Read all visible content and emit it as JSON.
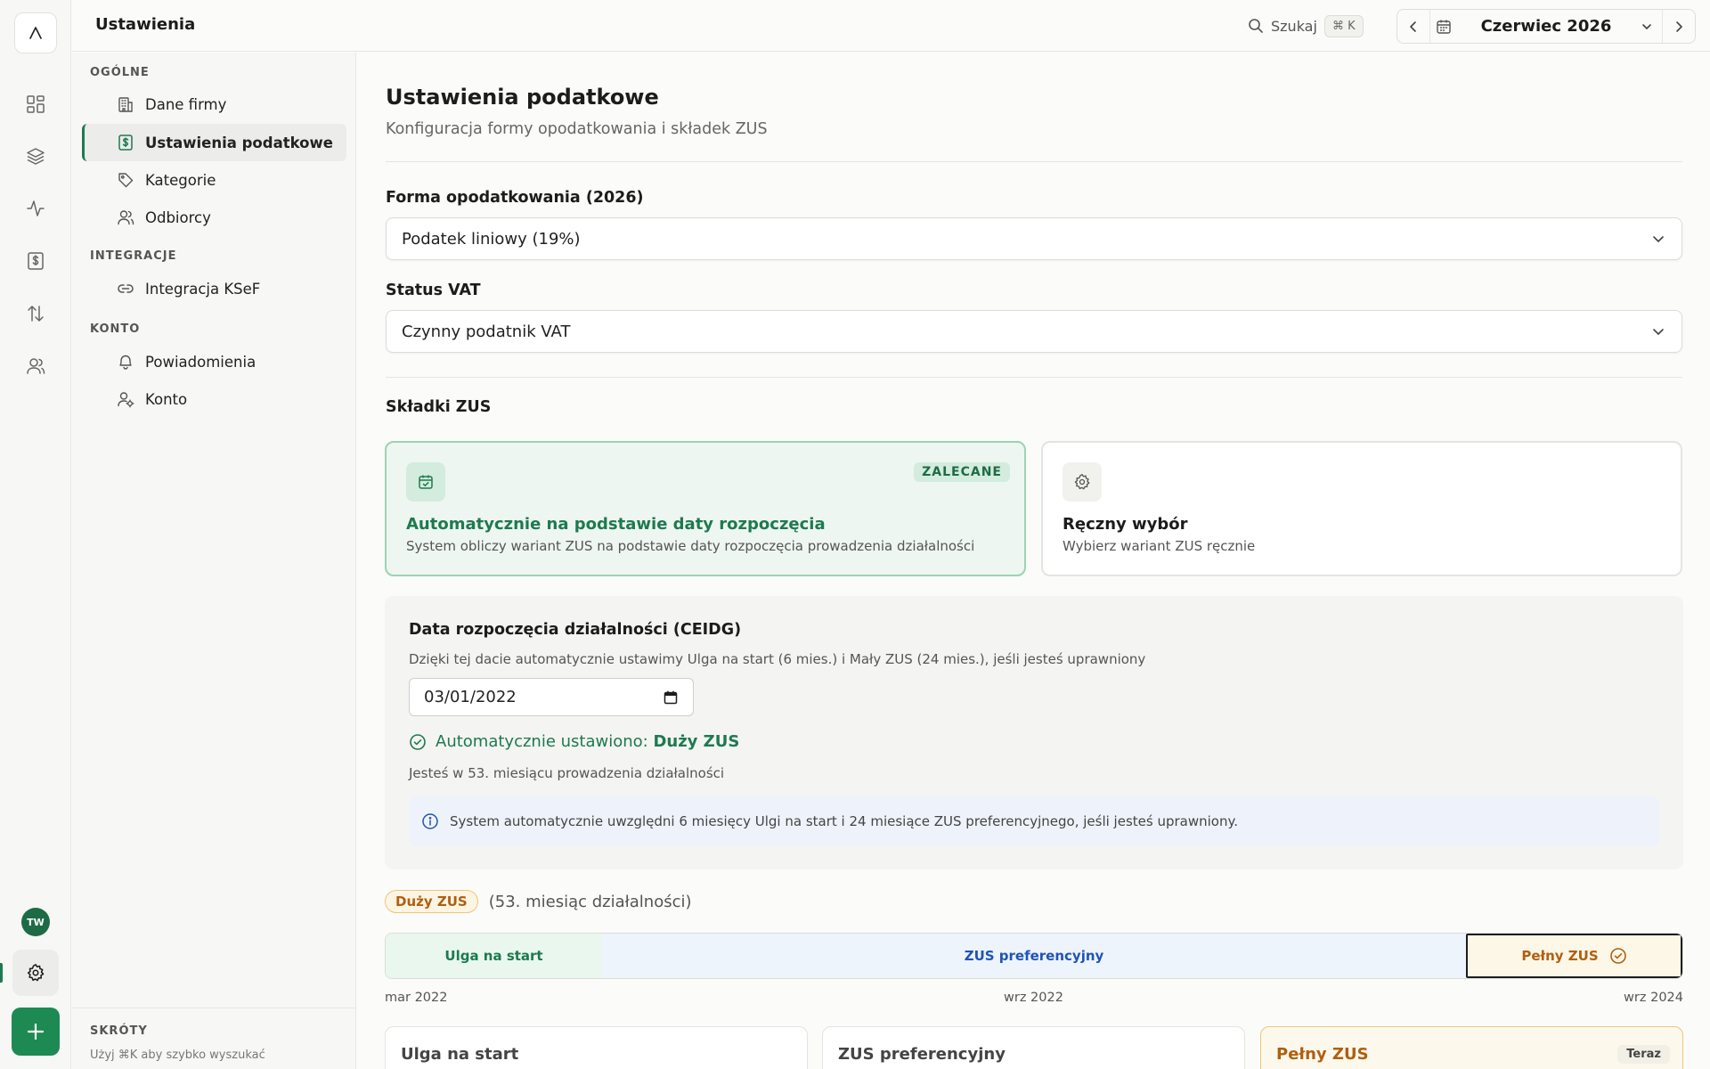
{
  "app": {
    "title": "Ustawienia",
    "user_initials": "TW"
  },
  "search": {
    "label": "Szukaj",
    "shortcut": "⌘ K"
  },
  "period": {
    "month": "Czerwiec 2026"
  },
  "sidebar": {
    "sections": [
      {
        "title": "OGÓLNE"
      },
      {
        "title": "INTEGRACJE"
      },
      {
        "title": "KONTO"
      }
    ],
    "items": [
      {
        "label": "Dane firmy",
        "icon": "building-icon"
      },
      {
        "label": "Ustawienia podatkowe",
        "icon": "tax-icon",
        "active": true
      },
      {
        "label": "Kategorie",
        "icon": "tag-icon"
      },
      {
        "label": "Odbiorcy",
        "icon": "users-icon"
      },
      {
        "label": "Integracja KSeF",
        "icon": "link-icon"
      },
      {
        "label": "Powiadomienia",
        "icon": "bell-icon"
      },
      {
        "label": "Konto",
        "icon": "user-gear-icon"
      }
    ],
    "shortcuts_title": "SKRÓTY",
    "shortcuts_hint": "Użyj ⌘K aby szybko wyszukać"
  },
  "page": {
    "title": "Ustawienia podatkowe",
    "description": "Konfiguracja formy opodatkowania i składek ZUS"
  },
  "tax_form": {
    "label": "Forma opodatkowania (2026)",
    "value": "Podatek liniowy (19%)"
  },
  "vat": {
    "label": "Status VAT",
    "value": "Czynny podatnik VAT"
  },
  "zus": {
    "section_title": "Składki ZUS",
    "auto_option": {
      "badge": "ZALECANE",
      "title": "Automatycznie na podstawie daty rozpoczęcia",
      "description": "System obliczy wariant ZUS na podstawie daty rozpoczęcia prowadzenia działalności"
    },
    "manual_option": {
      "title": "Ręczny wybór",
      "description": "Wybierz wariant ZUS ręcznie"
    },
    "start_date": {
      "title": "Data rozpoczęcia działalności (CEIDG)",
      "description": "Dzięki tej dacie automatycznie ustawimy Ulga na start (6 mies.) i Mały ZUS (24 mies.), jeśli jesteś uprawniony",
      "value": "03/01/2022",
      "auto_prefix": "Automatycznie ustawiono:",
      "auto_value": "Duży ZUS",
      "month_info": "Jesteś w 53. miesiącu prowadzenia działalności",
      "info": "System automatycznie uwzględni 6 miesięcy Ulgi na start i 24 miesiące ZUS preferencyjnego, jeśli jesteś uprawniony."
    },
    "current_state": {
      "badge": "Duży ZUS",
      "text": "(53. miesiąc działalności)"
    },
    "timeline": {
      "segments": [
        "Ulga na start",
        "ZUS preferencyjny",
        "Pełny ZUS"
      ],
      "labels": [
        "mar 2022",
        "wrz 2022",
        "wrz 2024"
      ]
    },
    "phase_cards": [
      {
        "title": "Ulga na start"
      },
      {
        "title": "ZUS preferencyjny"
      },
      {
        "title": "Pełny ZUS",
        "badge": "Teraz"
      }
    ]
  },
  "colors": {
    "accent": "#1d7a4f",
    "warning": "#b05f10",
    "info": "#1f54b5"
  }
}
